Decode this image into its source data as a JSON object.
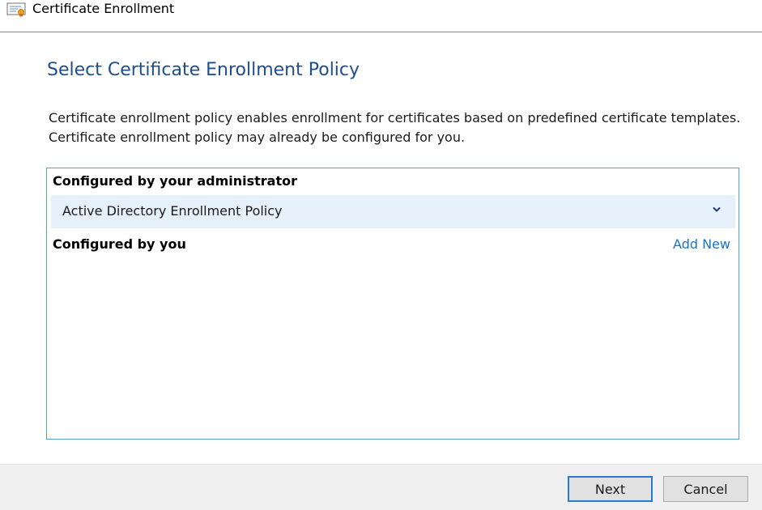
{
  "window": {
    "title": "Certificate Enrollment",
    "icon": "certificate-icon"
  },
  "page": {
    "heading": "Select Certificate Enrollment Policy",
    "description_line1": "Certificate enrollment policy enables enrollment for certificates based on predefined certificate templates.",
    "description_line2": "Certificate enrollment policy may already be configured for you."
  },
  "policies": {
    "admin_group_label": "Configured by your administrator",
    "admin_items": [
      {
        "name": "Active Directory Enrollment Policy",
        "icon": "chevron-down-icon"
      }
    ],
    "user_group_label": "Configured by you",
    "add_new_label": "Add New"
  },
  "footer": {
    "next_label": "Next",
    "cancel_label": "Cancel"
  },
  "colors": {
    "heading": "#1e4e8c",
    "link": "#1a73c8",
    "selected_row": "#e6f0fb",
    "box_border": "#5a9bd5",
    "default_button_border": "#2a7ad2"
  }
}
